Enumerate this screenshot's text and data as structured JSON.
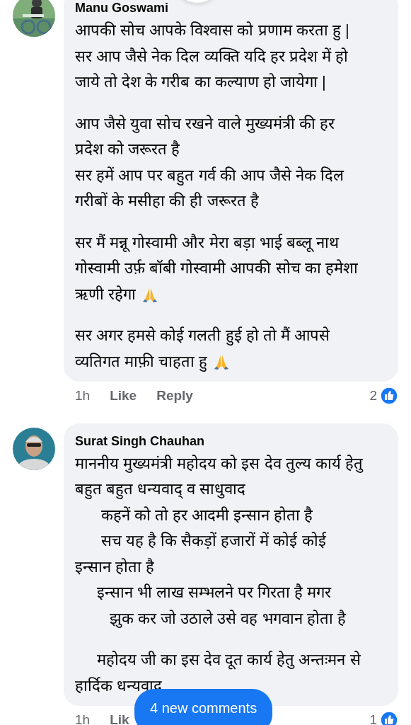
{
  "comments": [
    {
      "author": "Manu Goswami",
      "has_top_badge": true,
      "paragraphs": [
        [
          {
            "text": "आपकी सोच आपके विश्वास को प्रणाम करता हु |",
            "hands_icon": false
          },
          {
            "text": "सर आप जैसे नेक दिल व्यक्ति यदि हर प्रदेश में हो",
            "hands_icon": false
          },
          {
            "text": "जाये तो देश के गरीब का कल्याण हो जायेगा |",
            "hands_icon": false
          }
        ],
        [
          {
            "text": "आप जैसे युवा सोच रखने वाले मुख्यमंत्री की हर",
            "hands_icon": false
          },
          {
            "text": "प्रदेश को जरूरत है",
            "hands_icon": false
          },
          {
            "text": "सर हमें आप पर बहुत गर्व की आप जैसे नेक दिल",
            "hands_icon": false
          },
          {
            "text": "गरीबों के मसीहा की ही जरूरत है",
            "hands_icon": false
          }
        ],
        [
          {
            "text": "सर मैं मन्नू गोस्वामी और मेरा बड़ा भाई बब्लू नाथ",
            "hands_icon": false
          },
          {
            "text": "गोस्वामी उर्फ़ बॉबी गोस्वामी आपकी सोच का हमेशा",
            "hands_icon": false
          },
          {
            "text": "ऋणी रहेगा",
            "hands_icon": true
          }
        ],
        [
          {
            "text": "सर अगर हमसे कोई गलती हुई हो तो मैं आपसे",
            "hands_icon": false
          },
          {
            "text": "व्यतिगत माफ़ी चाहता हु",
            "hands_icon": true
          }
        ]
      ],
      "time": "1h",
      "actions": [
        "Like",
        "Reply"
      ],
      "reaction_count": "2"
    },
    {
      "author": "Surat Singh Chauhan",
      "has_top_badge": false,
      "paragraphs": [
        [
          {
            "text": "माननीय मुख्यमंत्री महोदय को इस देव तुल्य कार्य हेतु",
            "hands_icon": false
          },
          {
            "text": "बहुत बहुत धन्यवाद् व साधुवाद",
            "hands_icon": false
          },
          {
            "text": "      कहनें को तो हर आदमी इन्सान होता है",
            "hands_icon": false
          },
          {
            "text": "      सच यह है कि सैकड़ों हजारों में कोई कोई",
            "hands_icon": false
          },
          {
            "text": "इन्सान होता है",
            "hands_icon": false
          },
          {
            "text": "     इन्सान भी लाख सम्भलने पर गिरता है मगर",
            "hands_icon": false
          },
          {
            "text": "        झुक कर जो उठाले उसे वह भगवान होता है",
            "hands_icon": false
          }
        ],
        [
          {
            "text": "     महोदय जी का इस देव दूत कार्य हेतु अन्तःमन से",
            "hands_icon": false
          },
          {
            "text": "हार्दिक धन्यवाद",
            "hands_icon": false
          }
        ]
      ],
      "time": "1h",
      "actions": [
        "Lik"
      ],
      "reaction_count": "1"
    }
  ],
  "new_comments_pill": {
    "label": "4 new comments"
  }
}
